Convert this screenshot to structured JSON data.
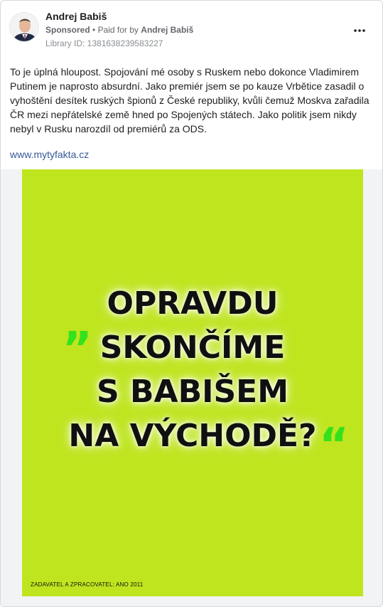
{
  "advertiser": {
    "name": "Andrej Babiš",
    "sponsored_label": "Sponsored",
    "separator": "•",
    "paid_for_prefix": "Paid for by",
    "payer": "Andrej Babiš",
    "library_id": "Library ID: 1381638239583227",
    "more_icon": "more-horizontal-icon"
  },
  "post": {
    "text": "To je úplná hloupost. Spojování mé osoby s Ruskem nebo dokonce Vladimirem Putinem je naprosto absurdní. Jako premiér jsem se po kauze Vrbětice zasadil o vyhoštění desítek ruských špionů z České republiky, kvůli čemuž Moskva zařadila ČR mezi nepřátelské země hned po Spojených státech. Jako politik jsem nikdy nebyl v Rusku narozdíl od premiérů za ODS.",
    "link": "www.mytyfakta.cz"
  },
  "creative": {
    "quote_open": "„",
    "quote_close": "“",
    "headline_lines": [
      "OPRAVDU",
      "SKONČÍME",
      "S BABIŠEM",
      "NA VÝCHODĚ?"
    ],
    "footer": "ZADAVATEL A ZPRACOVATEL: ANO 2011",
    "colors": {
      "background": "#bfe51e",
      "quote": "#33e21c",
      "text": "#101010"
    }
  },
  "colors": {
    "link": "#385898",
    "muted": "#65676b"
  }
}
